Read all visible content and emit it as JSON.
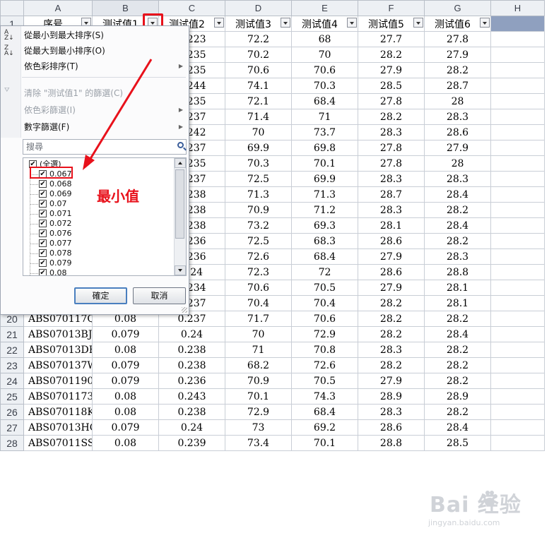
{
  "columns": [
    "A",
    "B",
    "C",
    "D",
    "E",
    "F",
    "G",
    "H"
  ],
  "header_row_num": "1",
  "headers": [
    "序号",
    "测试值1",
    "测试值2",
    "测试值3",
    "测试值4",
    "测试值5",
    "测试值6"
  ],
  "rows": [
    {
      "num": "2",
      "c": [
        "",
        "",
        "0.223",
        "72.2",
        "68",
        "27.7",
        "27.8"
      ]
    },
    {
      "num": "3",
      "c": [
        "",
        "",
        "0.235",
        "70.2",
        "70",
        "28.2",
        "27.9"
      ]
    },
    {
      "num": "4",
      "c": [
        "",
        "",
        "0.235",
        "70.6",
        "70.6",
        "27.9",
        "28.2"
      ]
    },
    {
      "num": "5",
      "c": [
        "",
        "",
        "0.244",
        "74.1",
        "70.3",
        "28.5",
        "28.7"
      ]
    },
    {
      "num": "6",
      "c": [
        "",
        "",
        "0.235",
        "72.1",
        "68.4",
        "27.8",
        "28"
      ]
    },
    {
      "num": "7",
      "c": [
        "",
        "",
        "0.237",
        "71.4",
        "71",
        "28.2",
        "28.3"
      ]
    },
    {
      "num": "8",
      "c": [
        "",
        "",
        "0.242",
        "70",
        "73.7",
        "28.3",
        "28.6"
      ]
    },
    {
      "num": "9",
      "c": [
        "",
        "",
        "0.237",
        "69.9",
        "69.8",
        "27.8",
        "27.9"
      ]
    },
    {
      "num": "10",
      "c": [
        "",
        "",
        "0.235",
        "70.3",
        "70.1",
        "27.8",
        "28"
      ]
    },
    {
      "num": "11",
      "c": [
        "",
        "",
        "0.237",
        "72.5",
        "69.9",
        "28.3",
        "28.3"
      ]
    },
    {
      "num": "12",
      "c": [
        "",
        "",
        "0.238",
        "71.3",
        "71.3",
        "28.7",
        "28.4"
      ]
    },
    {
      "num": "13",
      "c": [
        "",
        "",
        "0.238",
        "70.9",
        "71.2",
        "28.3",
        "28.2"
      ]
    },
    {
      "num": "14",
      "c": [
        "",
        "",
        "0.238",
        "73.2",
        "69.3",
        "28.1",
        "28.4"
      ]
    },
    {
      "num": "15",
      "c": [
        "",
        "",
        "0.236",
        "72.5",
        "68.3",
        "28.6",
        "28.2"
      ]
    },
    {
      "num": "16",
      "c": [
        "",
        "",
        "0.236",
        "72.6",
        "68.4",
        "27.9",
        "28.3"
      ]
    },
    {
      "num": "17",
      "c": [
        "",
        "",
        "0.24",
        "72.3",
        "72",
        "28.6",
        "28.8"
      ]
    },
    {
      "num": "18",
      "c": [
        "",
        "",
        "0.234",
        "70.6",
        "70.5",
        "27.9",
        "28.1"
      ]
    },
    {
      "num": "19",
      "c": [
        "",
        "",
        "0.237",
        "70.4",
        "70.4",
        "28.2",
        "28.1"
      ]
    },
    {
      "num": "20",
      "c": [
        "ABS070117Q",
        "0.08",
        "0.237",
        "71.7",
        "70.6",
        "28.2",
        "28.2"
      ]
    },
    {
      "num": "21",
      "c": [
        "ABS07013BJ",
        "0.079",
        "0.24",
        "70",
        "72.9",
        "28.2",
        "28.4"
      ]
    },
    {
      "num": "22",
      "c": [
        "ABS07013DH",
        "0.08",
        "0.238",
        "71",
        "70.8",
        "28.3",
        "28.2"
      ]
    },
    {
      "num": "23",
      "c": [
        "ABS070137W",
        "0.079",
        "0.238",
        "68.2",
        "72.6",
        "28.2",
        "28.2"
      ]
    },
    {
      "num": "24",
      "c": [
        "ABS0701190",
        "0.079",
        "0.236",
        "70.9",
        "70.5",
        "27.9",
        "28.2"
      ]
    },
    {
      "num": "25",
      "c": [
        "ABS0701173",
        "0.08",
        "0.243",
        "70.1",
        "74.3",
        "28.9",
        "28.9"
      ]
    },
    {
      "num": "26",
      "c": [
        "ABS070118K",
        "0.08",
        "0.238",
        "72.9",
        "68.4",
        "28.3",
        "28.2"
      ]
    },
    {
      "num": "27",
      "c": [
        "ABS07013HC",
        "0.079",
        "0.24",
        "73",
        "69.2",
        "28.6",
        "28.4"
      ]
    },
    {
      "num": "28",
      "c": [
        "ABS07011SS",
        "0.08",
        "0.239",
        "73.4",
        "70.1",
        "28.8",
        "28.5"
      ]
    }
  ],
  "filter_menu": {
    "sort_asc": "從最小到最大排序(S)",
    "sort_desc": "從最大到最小排序(O)",
    "sort_color": "依色彩排序(T)",
    "clear_filter": "清除 \"测试值1\" 的篩選(C)",
    "filter_color": "依色彩篩選(I)",
    "number_filter": "數字篩選(F)",
    "search_placeholder": "搜尋",
    "values": [
      "(全選)",
      "0.067",
      "0.068",
      "0.069",
      "0.07",
      "0.071",
      "0.072",
      "0.076",
      "0.077",
      "0.078",
      "0.079",
      "0.08"
    ],
    "ok": "確定",
    "cancel": "取消"
  },
  "annotation": "最小值",
  "colors": {
    "accent_red": "#e8111b",
    "header_tail": "#8fa0bf"
  },
  "watermark": {
    "brand": "Bai 经验",
    "url": "jingyan.baidu.com"
  }
}
